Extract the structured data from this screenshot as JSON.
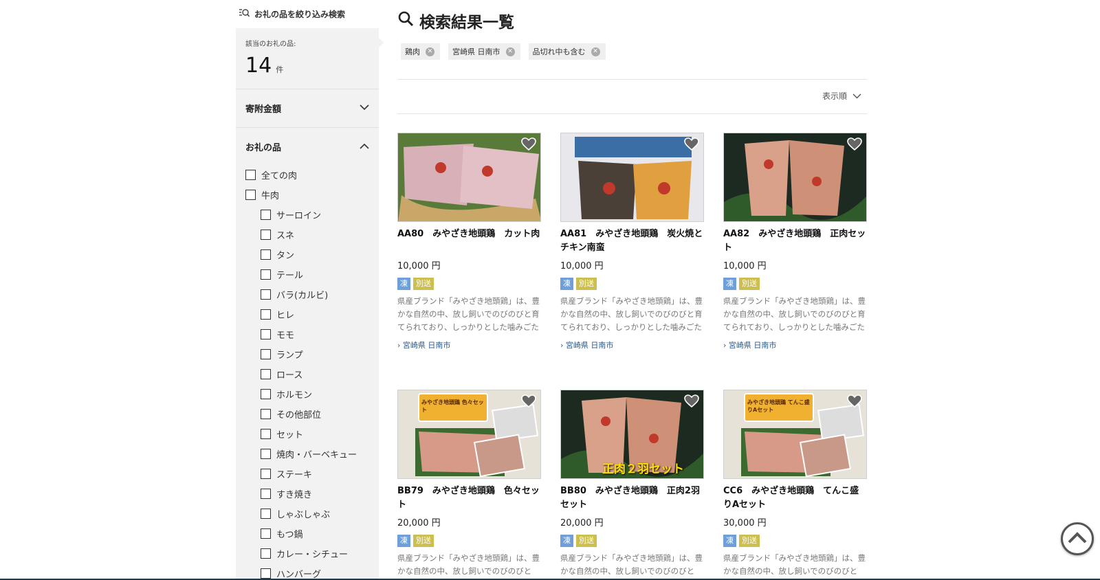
{
  "sidebar": {
    "search_label": "お礼の品を絞り込み検索",
    "count_label": "該当のお礼の品:",
    "count": "14",
    "count_unit": "件",
    "donation_label": "寄附金額",
    "gift_label": "お礼の品",
    "options": [
      {
        "label": "全ての肉",
        "sub": false
      },
      {
        "label": "牛肉",
        "sub": false
      },
      {
        "label": "サーロイン",
        "sub": true
      },
      {
        "label": "スネ",
        "sub": true
      },
      {
        "label": "タン",
        "sub": true
      },
      {
        "label": "テール",
        "sub": true
      },
      {
        "label": "バラ(カルビ)",
        "sub": true
      },
      {
        "label": "ヒレ",
        "sub": true
      },
      {
        "label": "モモ",
        "sub": true
      },
      {
        "label": "ランプ",
        "sub": true
      },
      {
        "label": "ロース",
        "sub": true
      },
      {
        "label": "ホルモン",
        "sub": true
      },
      {
        "label": "その他部位",
        "sub": true
      },
      {
        "label": "セット",
        "sub": true
      },
      {
        "label": "焼肉・バーベキュー",
        "sub": true
      },
      {
        "label": "ステーキ",
        "sub": true
      },
      {
        "label": "すき焼き",
        "sub": true
      },
      {
        "label": "しゃぶしゃぶ",
        "sub": true
      },
      {
        "label": "もつ鍋",
        "sub": true
      },
      {
        "label": "カレー・シチュー",
        "sub": true
      },
      {
        "label": "ハンバーグ",
        "sub": true
      }
    ]
  },
  "main": {
    "title": "検索結果一覧",
    "tags": [
      "鶏肉",
      "宮崎県 日南市",
      "品切れ中も含む"
    ],
    "sort_label": "表示順"
  },
  "products": [
    {
      "name": "AA80　みやざき地頭鶏　カット肉",
      "price": "10,000 円",
      "badge1": "凍",
      "badge2": "別送",
      "desc": "県産ブランド「みやざき地頭鶏」は、豊かな自然の中、放し飼いでのびのびと育てられており、しっかりとした噛みごたえの中に、素材のうまみを感じられる",
      "location": "宮崎県 日南市",
      "overlay": ""
    },
    {
      "name": "AA81　みやざき地頭鶏　炭火焼とチキン南蛮",
      "price": "10,000 円",
      "badge1": "凍",
      "badge2": "別送",
      "desc": "県産ブランド「みやざき地頭鶏」は、豊かな自然の中、放し飼いでのびのびと育てられており、しっかりとした噛みごたえの中に、素材のうまみを感じられる",
      "location": "宮崎県 日南市",
      "overlay": ""
    },
    {
      "name": "AA82　みやざき地頭鶏　正肉セット",
      "price": "10,000 円",
      "badge1": "凍",
      "badge2": "別送",
      "desc": "県産ブランド「みやざき地頭鶏」は、豊かな自然の中、放し飼いでのびのびと育てられており、しっかりとした噛みごたえの中に、素材のうまみを感じられる",
      "location": "宮崎県 日南市",
      "overlay": ""
    },
    {
      "name": "BB79　みやざき地頭鶏　色々セット",
      "price": "20,000 円",
      "badge1": "凍",
      "badge2": "別送",
      "desc": "県産ブランド「みやざき地頭鶏」は、豊かな自然の中、放し飼いでのびのびと",
      "location": "",
      "overlay": "みやざき地頭鶏 色々セット"
    },
    {
      "name": "BB80　みやざき地頭鶏　正肉2羽セット",
      "price": "20,000 円",
      "badge1": "凍",
      "badge2": "別送",
      "desc": "県産ブランド「みやざき地頭鶏」は、豊かな自然の中、放し飼いでのびのびと",
      "location": "",
      "overlay": "正肉２羽セット"
    },
    {
      "name": "CC6　みやざき地頭鶏　てんこ盛りAセット",
      "price": "30,000 円",
      "badge1": "凍",
      "badge2": "別送",
      "desc": "県産ブランド「みやざき地頭鶏」は、豊かな自然の中、放し飼いでのびのびと",
      "location": "",
      "overlay": "みやざき地頭鶏 てんこ盛りAセット"
    }
  ],
  "icons": {
    "filter": "filter-search-icon",
    "search": "search-icon",
    "heart": "heart-icon",
    "chevron_down": "chevron-down-icon",
    "chevron_up": "chevron-up-icon",
    "scroll_top": "scroll-to-top-icon"
  },
  "colors": {
    "frozen_badge": "#6f9fd8",
    "ship_badge": "#cdbf4f",
    "location_link": "#2b5a8a",
    "sidebar_bg": "#f2f2f2"
  }
}
